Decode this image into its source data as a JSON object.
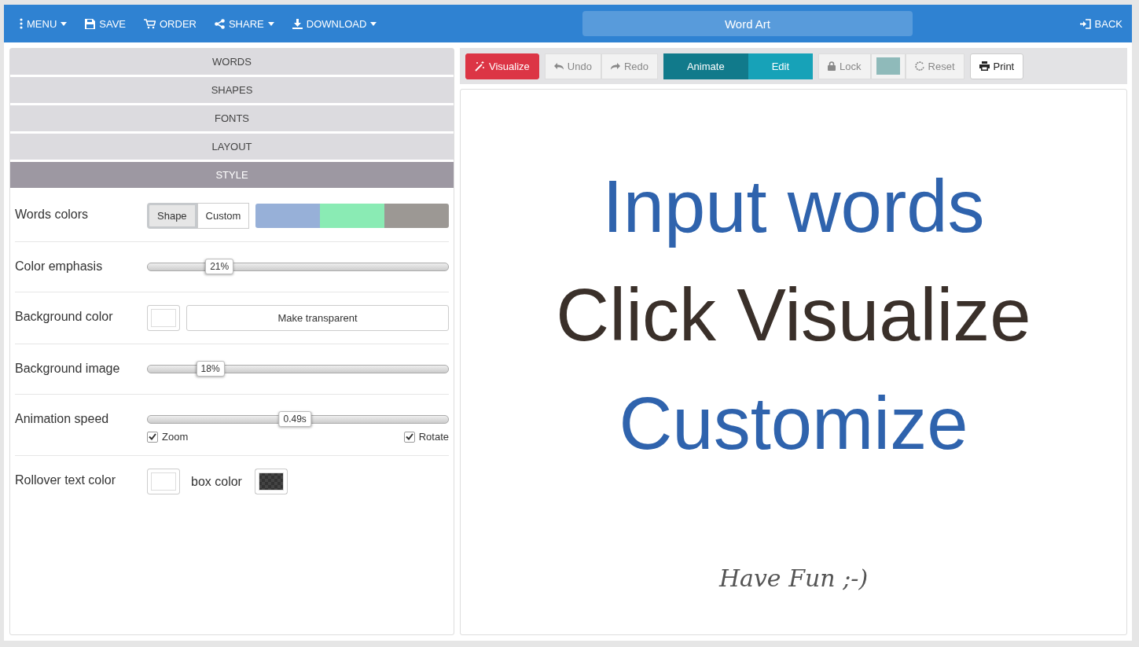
{
  "top_bar": {
    "menu": [
      {
        "label": "MENU",
        "dropdown": true
      },
      {
        "label": "SAVE",
        "dropdown": false
      },
      {
        "label": "ORDER",
        "dropdown": false
      },
      {
        "label": "SHARE",
        "dropdown": true
      },
      {
        "label": "DOWNLOAD",
        "dropdown": true
      }
    ],
    "title": "Word Art",
    "back": "BACK"
  },
  "sections": [
    {
      "label": "WORDS",
      "selected": false
    },
    {
      "label": "SHAPES",
      "selected": false
    },
    {
      "label": "FONTS",
      "selected": false
    },
    {
      "label": "LAYOUT",
      "selected": false
    },
    {
      "label": "STYLE",
      "selected": true
    }
  ],
  "style_rows": [
    {
      "kind": "colors",
      "label": "Words colors",
      "options": [
        {
          "label": "Shape",
          "selected": true
        },
        {
          "label": "Custom",
          "selected": false
        }
      ],
      "swatches": [
        {
          "color": "#97b0d8"
        },
        {
          "color": "#8aebb4"
        },
        {
          "color": "#9c9894"
        }
      ]
    },
    {
      "kind": "slider",
      "label": "Color emphasis",
      "level": 0.24,
      "reading": "21%"
    },
    {
      "kind": "background",
      "label": "Background color",
      "button": "Make transparent"
    },
    {
      "kind": "slider",
      "label": "Background image",
      "level": 0.21,
      "reading": "18%"
    },
    {
      "kind": "animation",
      "label": "Animation speed",
      "level": 0.49,
      "reading": "0.49s",
      "checks": [
        {
          "label": "Zoom",
          "checked": true
        },
        {
          "label": "Rotate",
          "checked": true
        }
      ]
    },
    {
      "kind": "rollover",
      "label": "Rollover text color",
      "second_label": "box color"
    }
  ],
  "toolbar": {
    "visualize": "Visualize",
    "undo": "Undo",
    "redo": "Redo",
    "modes": [
      {
        "label": "Animate",
        "selected": true
      },
      {
        "label": "Edit",
        "selected": false
      }
    ],
    "lock": "Lock",
    "reset": "Reset",
    "print": "Print"
  },
  "canvas_lines": [
    {
      "text": "Input words",
      "color": "#2f63ad",
      "kind": "big"
    },
    {
      "text": "Click Visualize",
      "color": "#3a302a",
      "kind": "big"
    },
    {
      "text": "Customize",
      "color": "#2f63ad",
      "kind": "big"
    },
    {
      "text": "Have Fun ;-)",
      "color": "#555555",
      "kind": "small"
    }
  ]
}
